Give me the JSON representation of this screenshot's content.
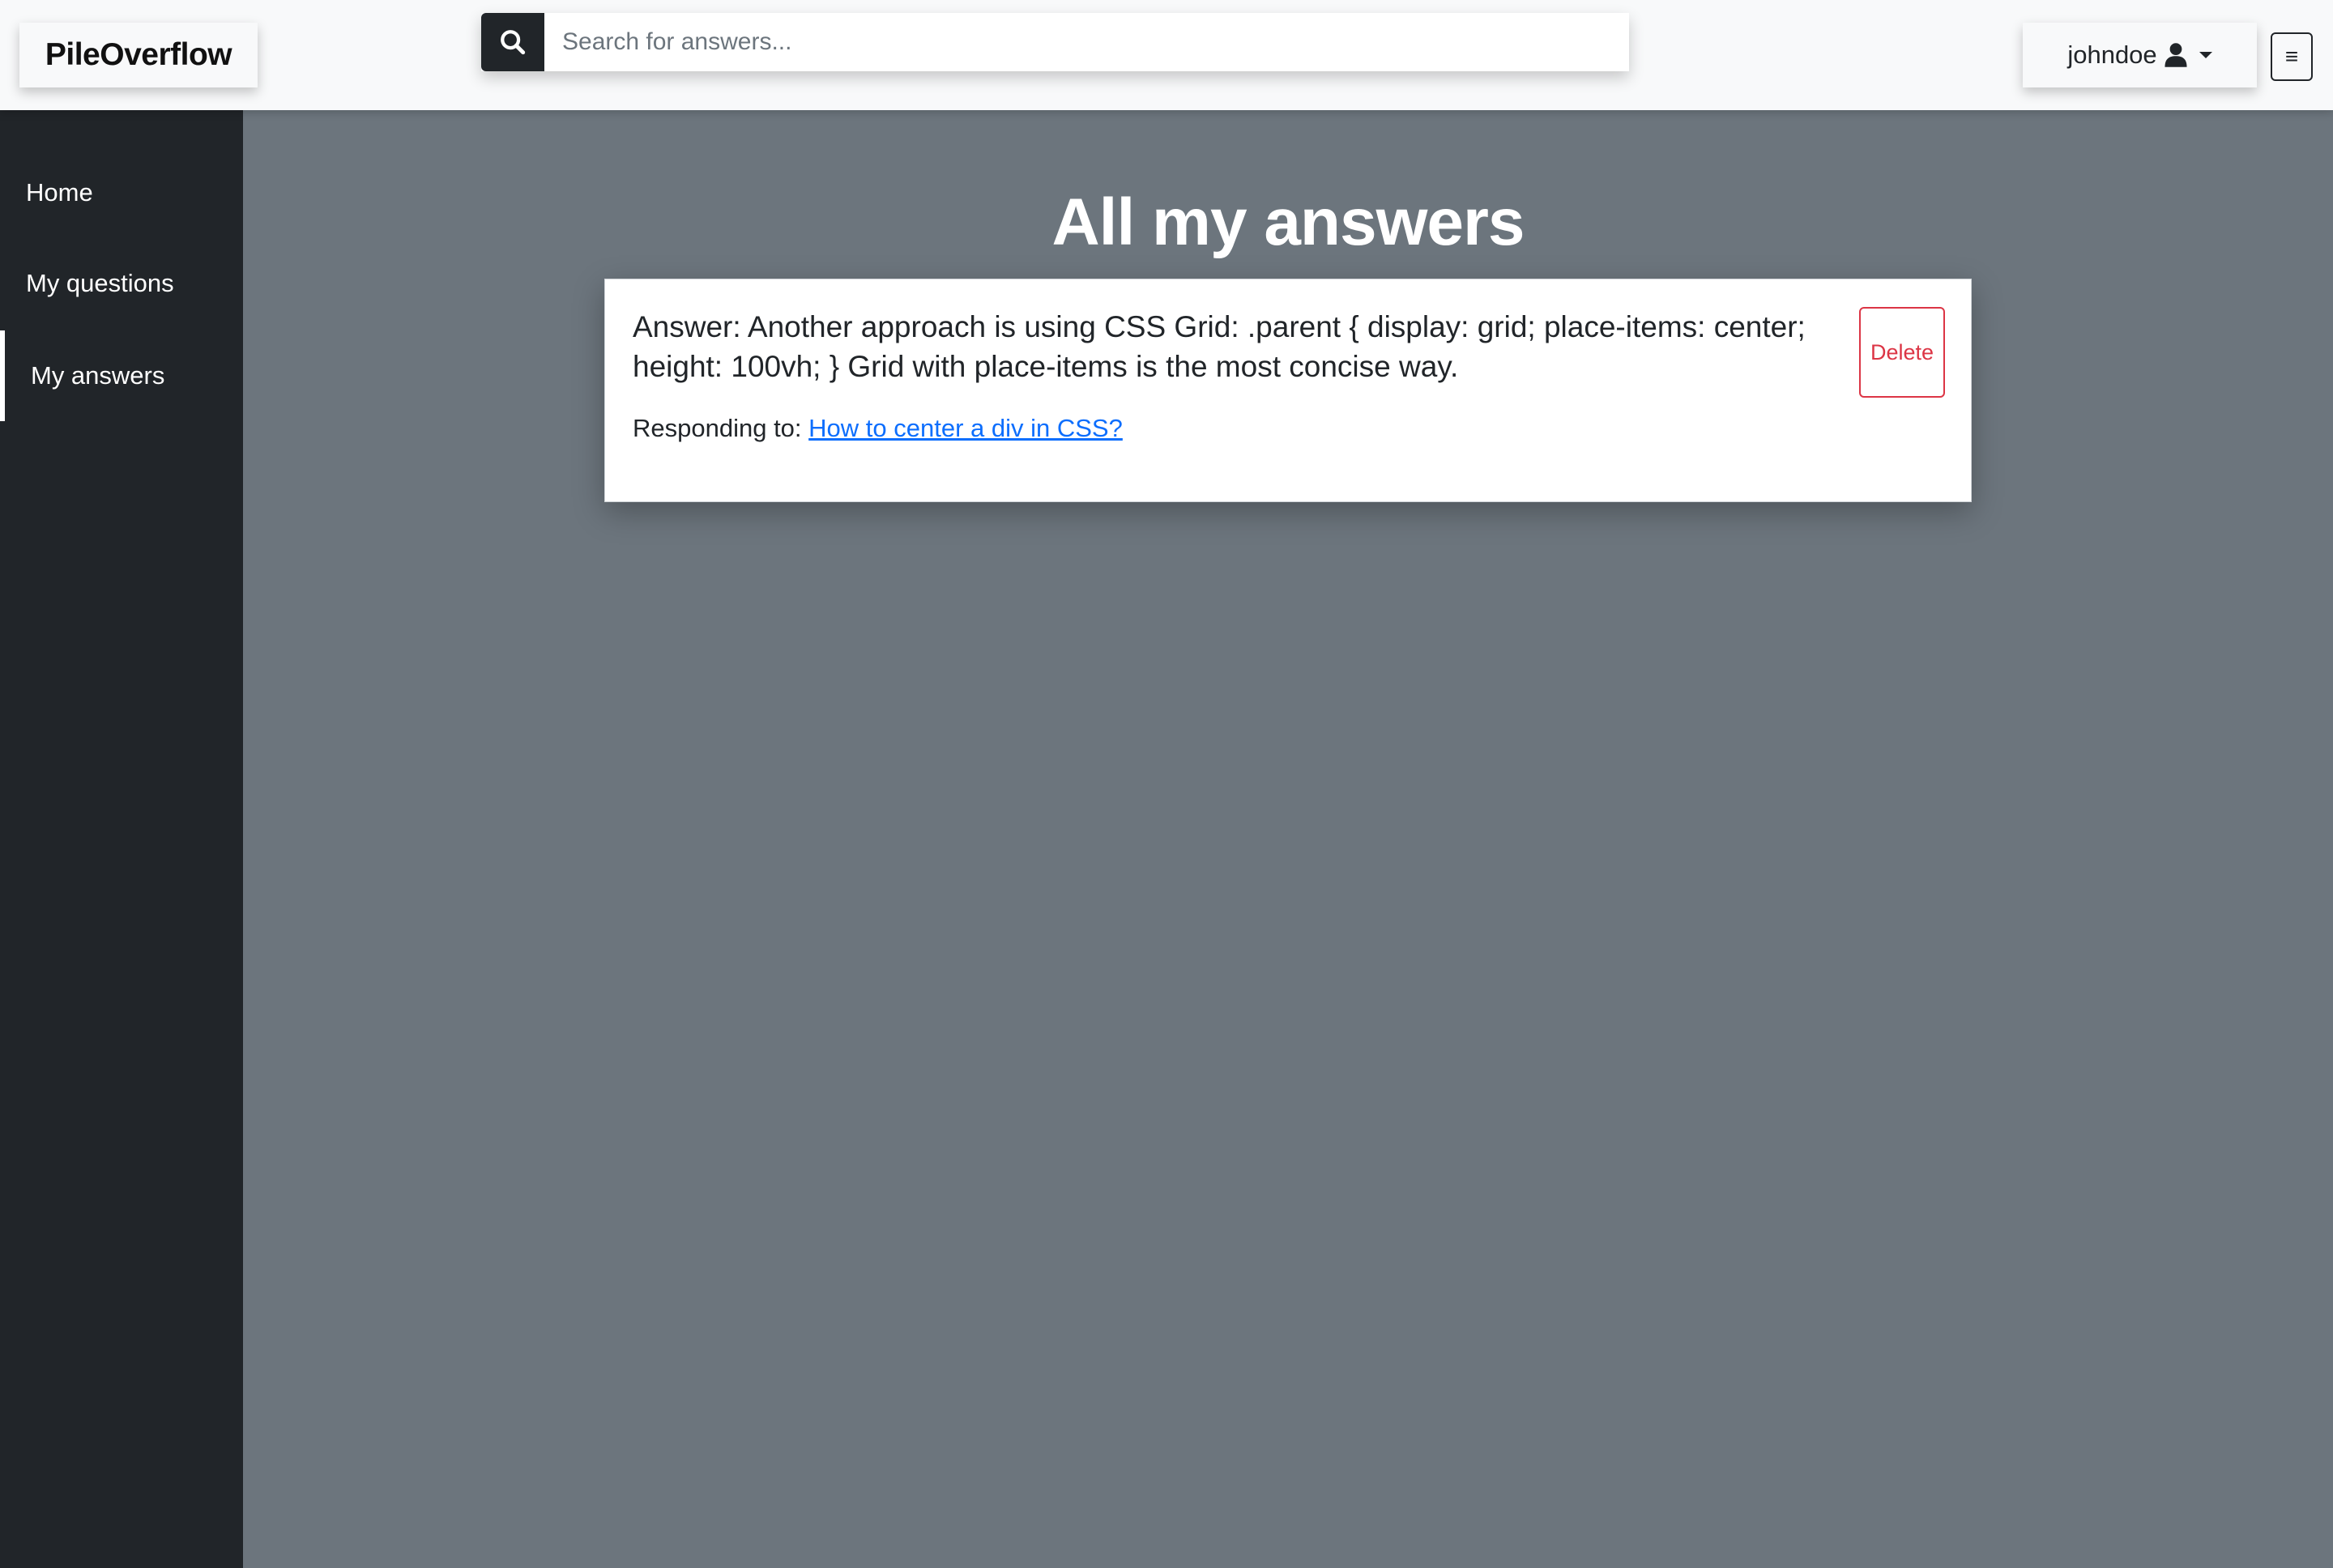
{
  "navbar": {
    "brand": "PileOverflow",
    "search": {
      "placeholder": "Search for answers...",
      "value": "",
      "icon": "search-icon"
    },
    "user": {
      "username": "johndoe",
      "icon": "user-icon"
    },
    "menu_toggle_label": "≡"
  },
  "sidebar": {
    "items": [
      {
        "label": "Home",
        "active": false
      },
      {
        "label": "My questions",
        "active": false
      },
      {
        "label": "My answers",
        "active": true
      }
    ]
  },
  "main": {
    "title": "All my answers",
    "answers": [
      {
        "text": "Answer: Another approach is using CSS Grid: .parent { display: grid; place-items: center; height: 100vh; } Grid with place-items is the most concise way.",
        "responding_label": "Responding to: ",
        "question_link": "How to center a div in CSS?",
        "delete_label": "Delete"
      }
    ]
  },
  "colors": {
    "navbar_bg": "#f8f9fa",
    "sidebar_bg": "#212529",
    "main_bg": "#6c757d",
    "link": "#0d6efd",
    "danger": "#dc3545"
  }
}
